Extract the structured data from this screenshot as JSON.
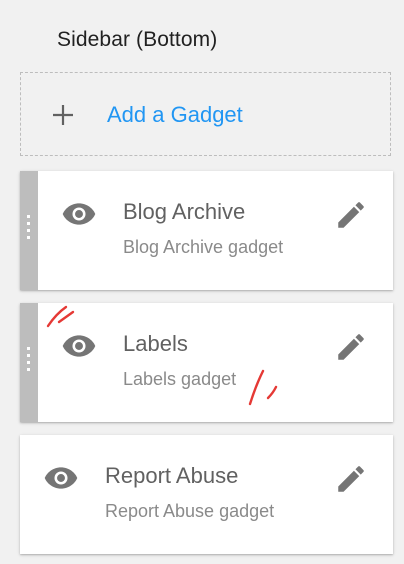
{
  "section": {
    "title": "Sidebar (Bottom)"
  },
  "add_gadget": {
    "label": "Add a Gadget",
    "icon": "plus-icon"
  },
  "gadgets": [
    {
      "title": "Blog Archive",
      "subtitle": "Blog Archive gadget",
      "draggable": true,
      "visible_icon": "eye-icon",
      "edit_icon": "pencil-icon"
    },
    {
      "title": "Labels",
      "subtitle": "Labels gadget",
      "draggable": true,
      "visible_icon": "eye-icon",
      "edit_icon": "pencil-icon"
    },
    {
      "title": "Report Abuse",
      "subtitle": "Report Abuse gadget",
      "draggable": false,
      "visible_icon": "eye-icon",
      "edit_icon": "pencil-icon"
    }
  ],
  "colors": {
    "accent": "#2196f3",
    "handle": "#bdbdbd",
    "icon": "#757575",
    "annotation": "#e53935"
  }
}
